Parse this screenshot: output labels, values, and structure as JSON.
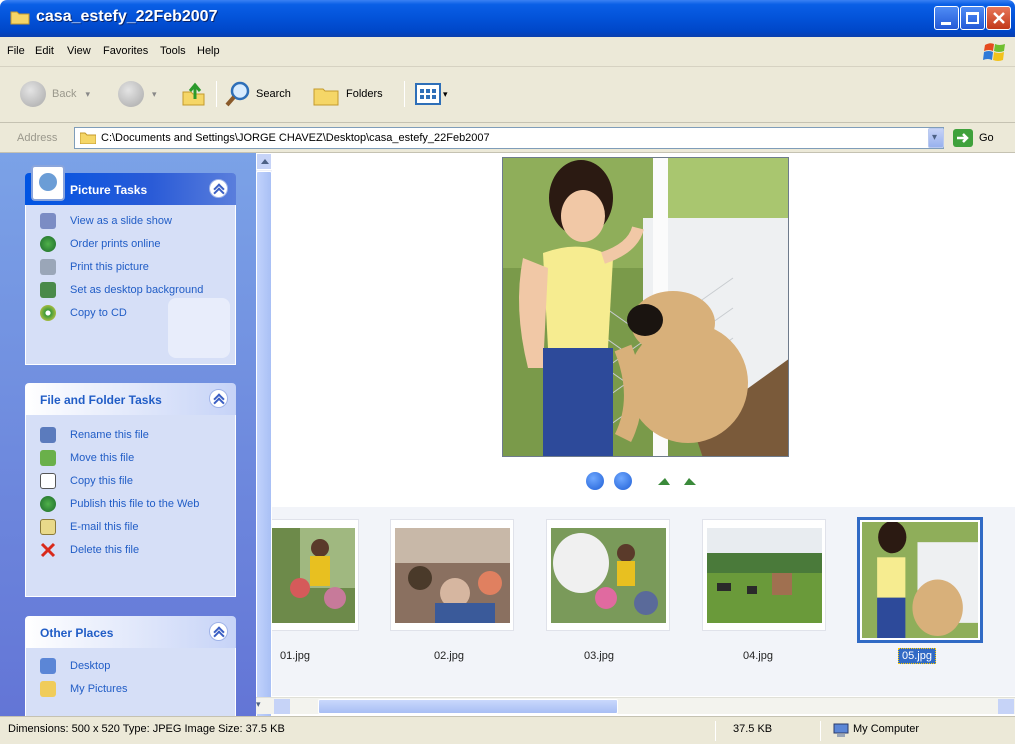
{
  "window": {
    "title": "casa_estefy_22Feb2007"
  },
  "menu": [
    "File",
    "Edit",
    "View",
    "Favorites",
    "Tools",
    "Help"
  ],
  "toolbar": {
    "back": "Back",
    "search": "Search",
    "folders": "Folders"
  },
  "address": {
    "label": "Address",
    "path": "C:\\Documents and Settings\\JORGE CHAVEZ\\Desktop\\casa_estefy_22Feb2007",
    "go": "Go"
  },
  "picture_tasks": {
    "title": "Picture Tasks",
    "items": [
      {
        "label": "View as a slide show",
        "icon": "slideshow-icon"
      },
      {
        "label": "Order prints online",
        "icon": "globe-icon"
      },
      {
        "label": "Print this picture",
        "icon": "printer-icon"
      },
      {
        "label": "Set as desktop background",
        "icon": "desktop-icon"
      },
      {
        "label": "Copy to CD",
        "icon": "cd-icon"
      }
    ]
  },
  "file_tasks": {
    "title": "File and Folder Tasks",
    "items": [
      {
        "label": "Rename this file",
        "icon": "rename-icon"
      },
      {
        "label": "Move this file",
        "icon": "move-icon"
      },
      {
        "label": "Copy this file",
        "icon": "copy-icon"
      },
      {
        "label": "Publish this file to the Web",
        "icon": "publish-icon"
      },
      {
        "label": "E-mail this file",
        "icon": "email-icon"
      },
      {
        "label": "Delete this file",
        "icon": "delete-icon"
      }
    ]
  },
  "other_places": {
    "title": "Other Places",
    "items": [
      {
        "label": "Desktop",
        "icon": "desktop-icon"
      },
      {
        "label": "My Pictures",
        "icon": "folder-icon"
      }
    ]
  },
  "thumbnails": [
    {
      "name": "01.jpg",
      "selected": false
    },
    {
      "name": "02.jpg",
      "selected": false
    },
    {
      "name": "03.jpg",
      "selected": false
    },
    {
      "name": "04.jpg",
      "selected": false
    },
    {
      "name": "05.jpg",
      "selected": true
    }
  ],
  "status": {
    "info": "Dimensions: 500 x 520 Type: JPEG Image Size: 37.5 KB",
    "size": "37.5 KB",
    "zone": "My Computer"
  }
}
